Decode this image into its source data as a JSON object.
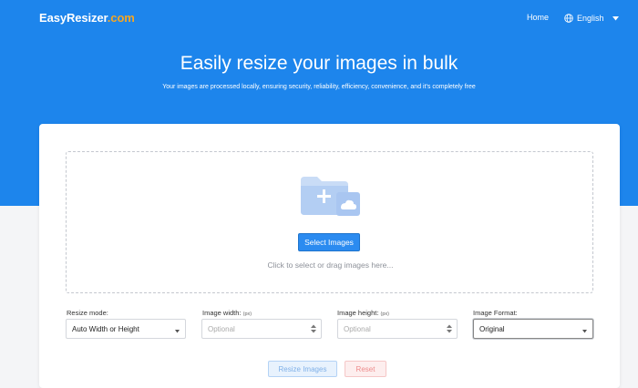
{
  "nav": {
    "logo_main": "EasyResizer",
    "logo_suffix": ".com",
    "home_label": "Home",
    "language_label": "English"
  },
  "hero": {
    "title": "Easily resize your images in bulk",
    "subtitle": "Your images are processed locally, ensuring security, reliability, efficiency, convenience, and it's completely free"
  },
  "upload": {
    "select_button": "Select Images",
    "hint": "Click to select or drag images here..."
  },
  "form": {
    "resize_mode": {
      "label": "Resize mode:",
      "value": "Auto Width or Height"
    },
    "width": {
      "label": "Image width:",
      "unit": "(px)",
      "placeholder": "Optional"
    },
    "height": {
      "label": "Image height:",
      "unit": "(px)",
      "placeholder": "Optional"
    },
    "format": {
      "label": "Image Format:",
      "value": "Original"
    }
  },
  "actions": {
    "resize_label": "Resize Images",
    "reset_label": "Reset"
  },
  "colors": {
    "header_blue": "#1d85ec",
    "logo_accent": "#f5a623",
    "primary_button": "#2b8bf0"
  },
  "icons": [
    "globe-icon",
    "caret-down-icon",
    "folder-cloud-icon",
    "select-arrow-icon",
    "spinner-icon"
  ]
}
